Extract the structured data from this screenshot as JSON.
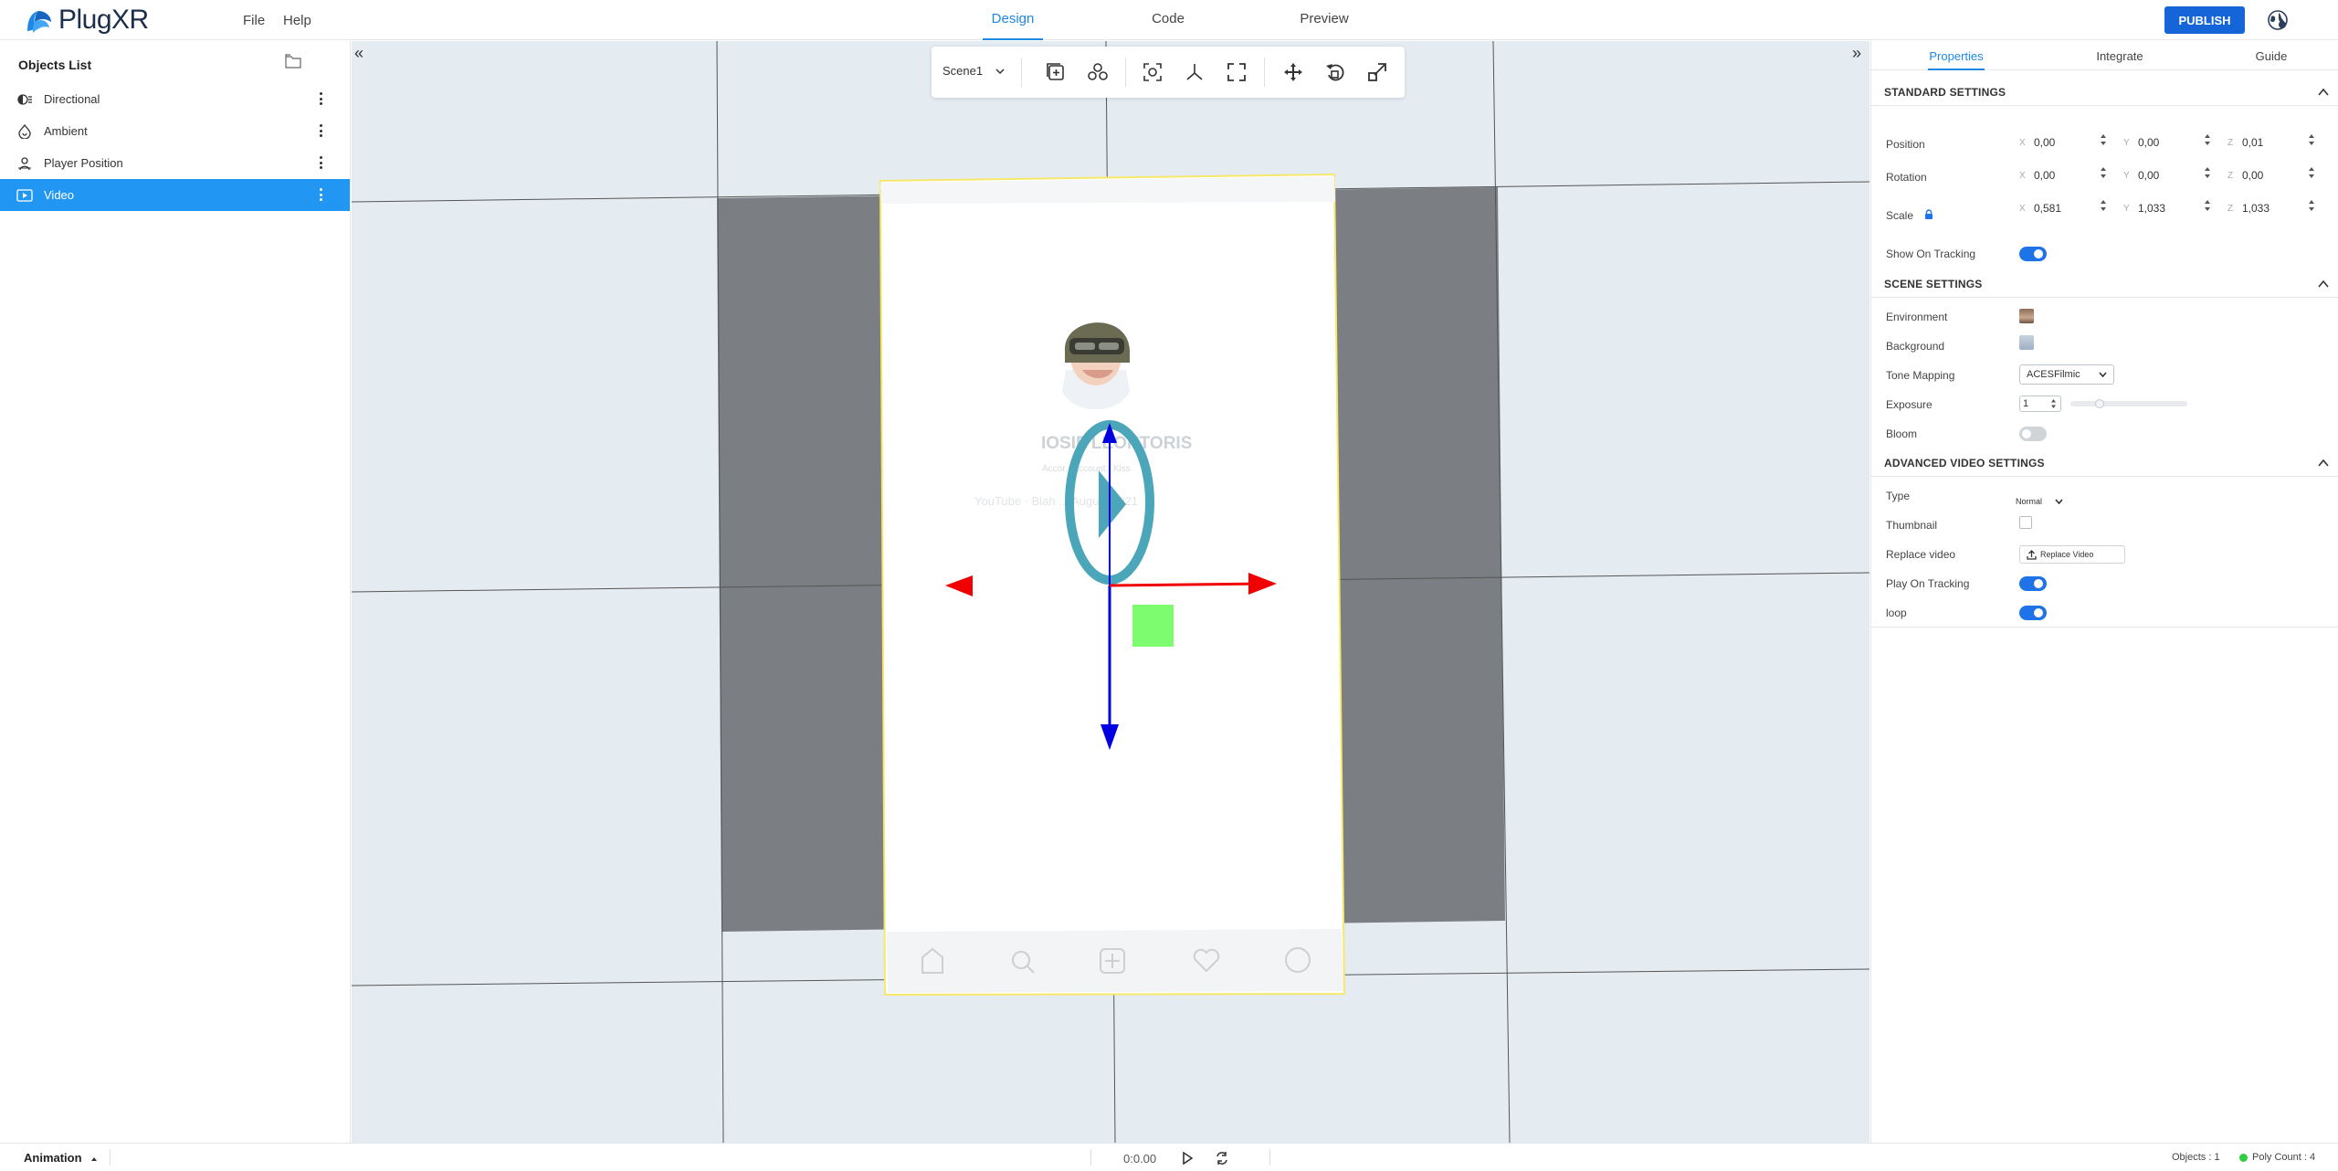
{
  "app": {
    "logo_text": "PlugXR",
    "menu": [
      "File",
      "Help"
    ],
    "tabs": [
      "Design",
      "Code",
      "Preview"
    ],
    "active_tab": "Design",
    "publish_label": "PUBLISH"
  },
  "left_panel": {
    "title": "Objects List",
    "items": [
      {
        "label": "Directional",
        "icon": "directional-light-icon"
      },
      {
        "label": "Ambient",
        "icon": "ambient-light-icon"
      },
      {
        "label": "Player Position",
        "icon": "player-position-icon"
      },
      {
        "label": "Video",
        "icon": "video-icon",
        "selected": true
      }
    ]
  },
  "toolbar": {
    "scene_select": "Scene1"
  },
  "canvas": {
    "profile_name": "IOSIF LEONTORIS",
    "profile_sub": "Accor...Account...Kiss",
    "profile_date": "YouTube · Blah ... August 2021"
  },
  "right_panel": {
    "tabs": [
      "Properties",
      "Integrate",
      "Guide"
    ],
    "active_tab": "Properties",
    "standard": {
      "title": "STANDARD SETTINGS",
      "position_label": "Position",
      "position": {
        "x": "0,00",
        "y": "0,00",
        "z": "0,01"
      },
      "rotation_label": "Rotation",
      "rotation": {
        "x": "0,00",
        "y": "0,00",
        "z": "0,00"
      },
      "scale_label": "Scale",
      "scale": {
        "x": "0,581",
        "y": "1,033",
        "z": "1,033"
      },
      "show_on_tracking_label": "Show On Tracking",
      "show_on_tracking": true
    },
    "scene": {
      "title": "SCENE SETTINGS",
      "environment_label": "Environment",
      "background_label": "Background",
      "tone_mapping_label": "Tone Mapping",
      "tone_mapping_value": "ACESFilmic",
      "exposure_label": "Exposure",
      "exposure_value": "1",
      "exposure_level": 0.25,
      "bloom_label": "Bloom",
      "bloom": false
    },
    "video": {
      "title": "ADVANCED VIDEO SETTINGS",
      "type_label": "Type",
      "type_value": "Normal",
      "thumbnail_label": "Thumbnail",
      "replace_label": "Replace video",
      "replace_button": "Replace Video",
      "play_on_tracking_label": "Play On Tracking",
      "play_on_tracking": true,
      "loop_label": "loop",
      "loop": true
    }
  },
  "bottom": {
    "animation_label": "Animation",
    "time": "0:0.00",
    "objects_status": "Objects : 1",
    "poly_status": "Poly Count : 4"
  },
  "colors": {
    "accent": "#1e88e5",
    "publish": "#1565d8",
    "selected_row": "#2196f3",
    "viewport_bg": "#e4ebf1",
    "plane_gray": "#7b7e82",
    "gizmo_x": "#f00000",
    "gizmo_y": "#0000e0",
    "gizmo_square": "#7dfc6f",
    "play_icon": "#4aa6b8"
  }
}
